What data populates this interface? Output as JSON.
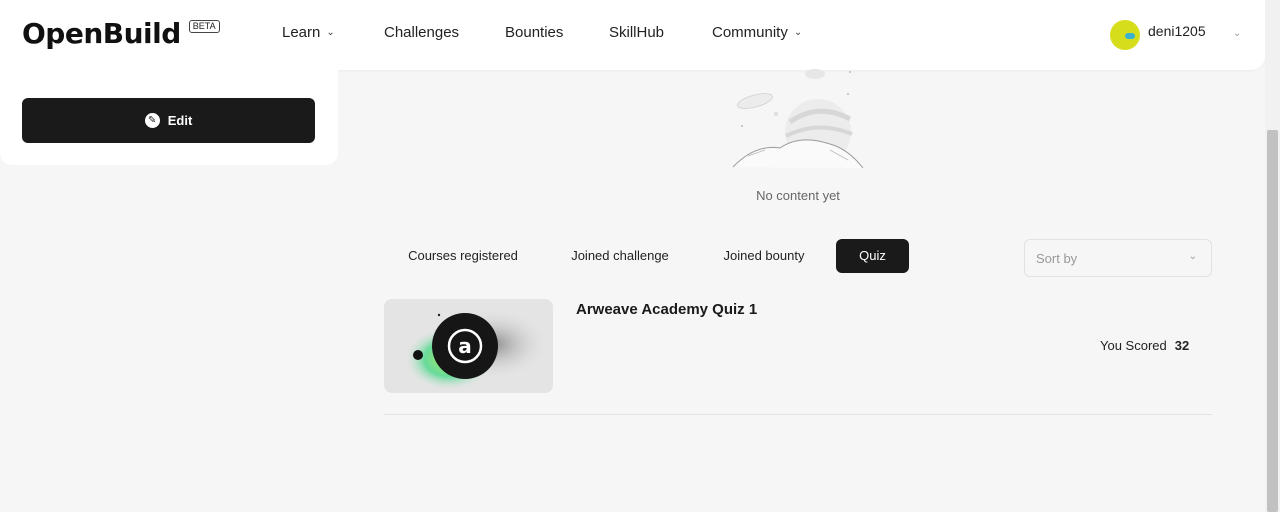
{
  "brand": {
    "name": "OpenBuild",
    "badge": "BETA"
  },
  "nav": {
    "learn": "Learn",
    "challenges": "Challenges",
    "bounties": "Bounties",
    "skillhub": "SkillHub",
    "community": "Community"
  },
  "user": {
    "name": "deni1205"
  },
  "profile": {
    "edit_label": "Edit"
  },
  "empty_state": {
    "text": "No content yet"
  },
  "tabs": [
    {
      "label": "Courses registered",
      "active": false
    },
    {
      "label": "Joined challenge",
      "active": false
    },
    {
      "label": "Joined bounty",
      "active": false
    },
    {
      "label": "Quiz",
      "active": true
    }
  ],
  "sort": {
    "placeholder": "Sort by"
  },
  "quizzes": [
    {
      "title": "Arweave Academy Quiz 1",
      "score_label": "You Scored",
      "score": "32"
    }
  ],
  "colors": {
    "accent_dark": "#1a1a1a",
    "avatar": "#d6dd1a",
    "background": "#f6f6f6"
  }
}
